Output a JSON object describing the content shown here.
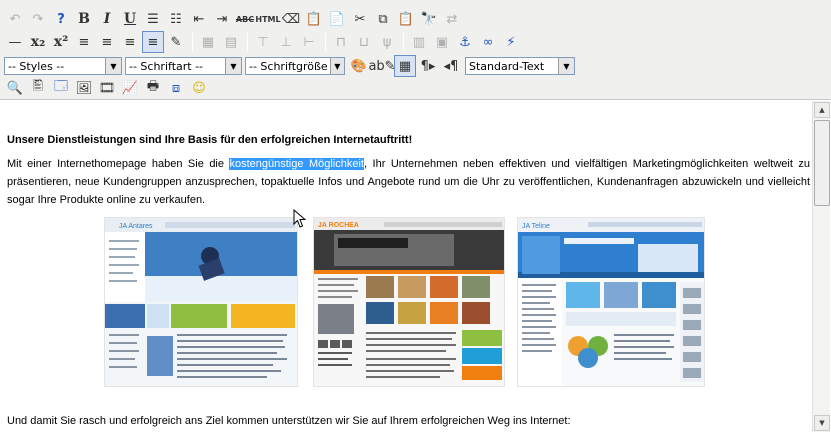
{
  "toolbar": {
    "row1": [
      {
        "name": "undo-button",
        "glyph": "↶",
        "disabled": true
      },
      {
        "name": "redo-button",
        "glyph": "↷",
        "disabled": true
      },
      {
        "name": "help-button",
        "glyph": "?",
        "style": "help"
      },
      {
        "name": "bold-button",
        "glyph": "B",
        "style": "bold"
      },
      {
        "name": "italic-button",
        "glyph": "I",
        "style": "italic"
      },
      {
        "name": "underline-button",
        "glyph": "U",
        "style": "underline"
      },
      {
        "name": "bullet-list-button",
        "glyph": "☰"
      },
      {
        "name": "numbered-list-button",
        "glyph": "☷"
      },
      {
        "name": "outdent-button",
        "glyph": "⇤"
      },
      {
        "name": "indent-button",
        "glyph": "⇥"
      },
      {
        "name": "strikethrough-button",
        "glyph": "ABC",
        "style": "small strike"
      },
      {
        "name": "html-button",
        "glyph": "HTML",
        "style": "small html"
      },
      {
        "name": "clean-formatting-button",
        "glyph": "⌫"
      },
      {
        "name": "paste-text-button",
        "glyph": "📋"
      },
      {
        "name": "paste-word-button",
        "glyph": "📄"
      },
      {
        "name": "cut-button",
        "glyph": "✂"
      },
      {
        "name": "copy-button",
        "glyph": "⧉"
      },
      {
        "name": "paste-button",
        "glyph": "📋"
      },
      {
        "name": "find-button",
        "glyph": "🔭"
      },
      {
        "name": "replace-button",
        "glyph": "⇄",
        "disabled": true
      }
    ],
    "row2": [
      {
        "name": "horizontal-rule-button",
        "glyph": "—"
      },
      {
        "name": "subscript-button",
        "glyph": "x₂",
        "style": "bold"
      },
      {
        "name": "superscript-button",
        "glyph": "x²",
        "style": "bold"
      },
      {
        "name": "align-left-button",
        "glyph": "≡"
      },
      {
        "name": "align-center-button",
        "glyph": "≡"
      },
      {
        "name": "align-right-button",
        "glyph": "≡"
      },
      {
        "name": "justify-button",
        "glyph": "≡",
        "active": true
      },
      {
        "name": "edit-button",
        "glyph": "✎"
      },
      {
        "sep": true
      },
      {
        "name": "table-insert-button",
        "glyph": "▦",
        "disabled": true
      },
      {
        "name": "table-props-button",
        "glyph": "▤",
        "disabled": true
      },
      {
        "sep": true
      },
      {
        "name": "row-before-button",
        "glyph": "⊤",
        "disabled": true
      },
      {
        "name": "row-after-button",
        "glyph": "⊥",
        "disabled": true
      },
      {
        "name": "delete-row-button",
        "glyph": "⊢",
        "disabled": true
      },
      {
        "sep": true
      },
      {
        "name": "col-before-button",
        "glyph": "⊓",
        "disabled": true
      },
      {
        "name": "col-after-button",
        "glyph": "⊔",
        "disabled": true
      },
      {
        "name": "delete-col-button",
        "glyph": "ψ",
        "disabled": true
      },
      {
        "sep": true
      },
      {
        "name": "split-cells-button",
        "glyph": "▥",
        "disabled": true
      },
      {
        "name": "merge-cells-button",
        "glyph": "▣",
        "disabled": true
      },
      {
        "name": "anchor-button",
        "glyph": "⚓"
      },
      {
        "name": "link-button",
        "glyph": "∞"
      },
      {
        "name": "unlink-button",
        "glyph": "⚡"
      }
    ],
    "row3": {
      "styles_value": "-- Styles --",
      "font_value": "-- Schriftart --",
      "size_value": "-- Schriftgröße --",
      "format_value": "Standard-Text",
      "buttons": [
        {
          "name": "forecolor-button",
          "glyph": "🎨"
        },
        {
          "name": "backcolor-button",
          "glyph": "ab✎"
        },
        {
          "name": "visual-aid-button",
          "glyph": "▦",
          "active": true
        },
        {
          "name": "ltr-button",
          "glyph": "¶▸"
        },
        {
          "name": "rtl-button",
          "glyph": "◂¶"
        }
      ]
    },
    "row4": [
      {
        "name": "search-zoom-button",
        "glyph": "🔍"
      },
      {
        "name": "preview-button",
        "glyph": "🖺"
      },
      {
        "name": "window-button",
        "glyph": "🗔"
      },
      {
        "name": "image-button",
        "glyph": "🖼"
      },
      {
        "name": "media-button",
        "glyph": "🎞"
      },
      {
        "name": "chart-button",
        "glyph": "📈"
      },
      {
        "name": "print-button",
        "glyph": "🖶"
      },
      {
        "name": "fullscreen-button",
        "glyph": "⧈"
      },
      {
        "name": "emoticon-button",
        "glyph": "☺"
      }
    ]
  },
  "content": {
    "headline": "Unsere Dienstleistungen sind Ihre Basis für den erfolgreichen Internetauftritt!",
    "para_before": "Mit einer Internethomepage haben Sie die ",
    "para_selected": "kostengünstige Möglichkeit",
    "para_after": ", Ihr Unternehmen neben effektiven und vielfältigen Marketingmöglichkeiten weltweit zu präsentieren, neue Kundengruppen anzusprechen, topaktuelle Infos und Angebote rund um die Uhr zu veröffentlichen, Kundenanfragen abzuwickeln und vielleicht sogar Ihre Produkte online zu verkaufen.",
    "closing": "Und damit Sie rasch und erfolgreich ans Ziel kommen unterstützen wir Sie auf Ihrem erfolgreichen Weg ins Internet:"
  },
  "images": [
    {
      "name": "template-ja-antares",
      "label": "JA Antares",
      "accent": "#2a7fc9"
    },
    {
      "name": "template-ja-rochea",
      "label": "JA ROCHEA",
      "accent": "#f07f10"
    },
    {
      "name": "template-ja-teline",
      "label": "JA Teline",
      "accent": "#2f7fd0"
    }
  ],
  "colors": {
    "selection": "#3399ff",
    "toolbar_bg": "#f0f0ee"
  }
}
